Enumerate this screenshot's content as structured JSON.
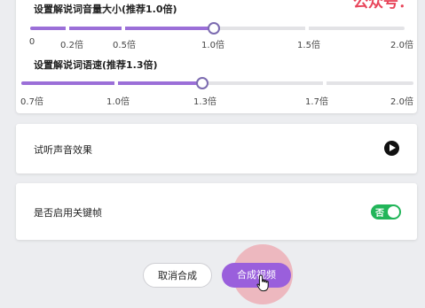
{
  "sliders": {
    "volume": {
      "title": "设置解说词音量大小(推荐1.0倍)",
      "ticks": [
        "0",
        "0.2倍",
        "0.5倍",
        "1.0倍",
        "1.5倍",
        "2.0倍"
      ],
      "value": "1.0"
    },
    "speed": {
      "title": "设置解说词语速(推荐1.3倍)",
      "ticks": [
        "0.7倍",
        "1.0倍",
        "1.3倍",
        "1.7倍",
        "2.0倍"
      ],
      "value": "1.3"
    }
  },
  "preview": {
    "label": "试听声音效果",
    "icon": "play-icon"
  },
  "keyframe": {
    "label": "是否启用关键帧",
    "toggle_text": "否"
  },
  "buttons": {
    "cancel": "取消合成",
    "compose": "合成视频"
  },
  "watermark": "公众号："
}
